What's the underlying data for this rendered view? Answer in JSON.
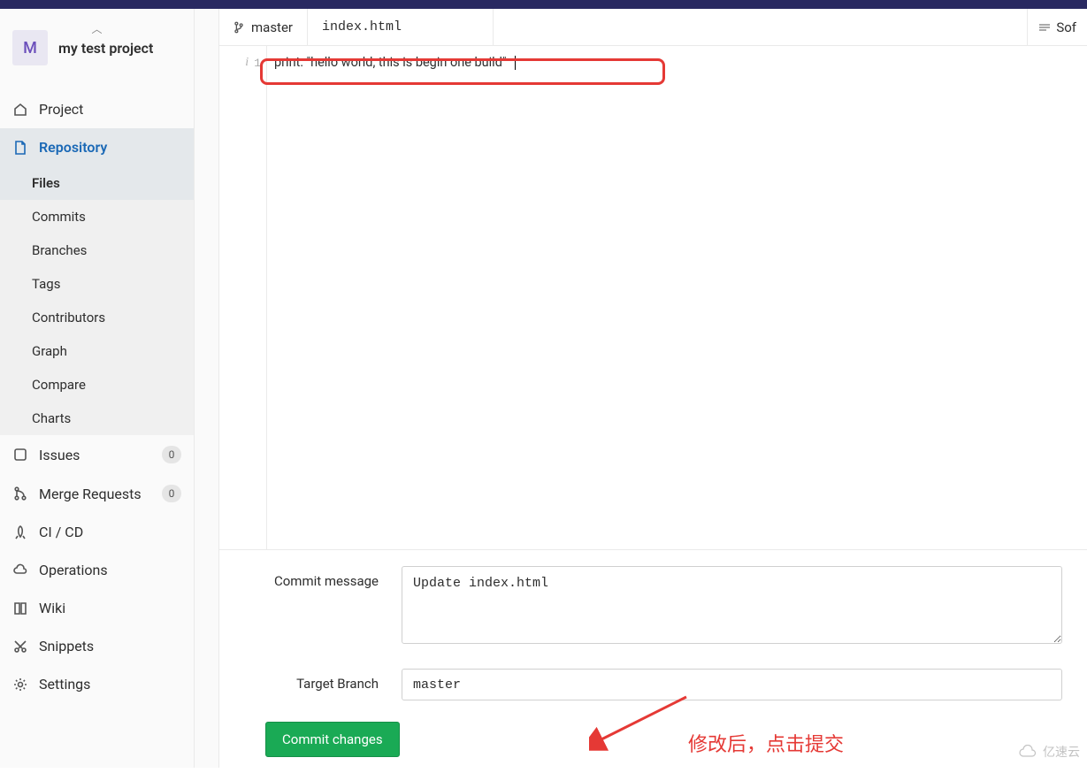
{
  "project": {
    "avatar_letter": "M",
    "title": "my test project"
  },
  "sidebar": {
    "project": "Project",
    "repository": "Repository",
    "repo_items": [
      "Files",
      "Commits",
      "Branches",
      "Tags",
      "Contributors",
      "Graph",
      "Compare",
      "Charts"
    ],
    "issues": {
      "label": "Issues",
      "count": "0"
    },
    "merge": {
      "label": "Merge Requests",
      "count": "0"
    },
    "cicd": "CI / CD",
    "operations": "Operations",
    "wiki": "Wiki",
    "snippets": "Snippets",
    "settings": "Settings"
  },
  "editor": {
    "branch": "master",
    "filename": "index.html",
    "wrap_toggle": "Sof",
    "line_num": "1",
    "code_line": "print: \"hello world, this is begin one build\""
  },
  "form": {
    "commit_msg_label": "Commit message",
    "commit_msg_value": "Update index.html",
    "target_branch_label": "Target Branch",
    "target_branch_value": "master",
    "commit_btn": "Commit changes"
  },
  "annotation": "修改后，点击提交",
  "watermark": "亿速云"
}
